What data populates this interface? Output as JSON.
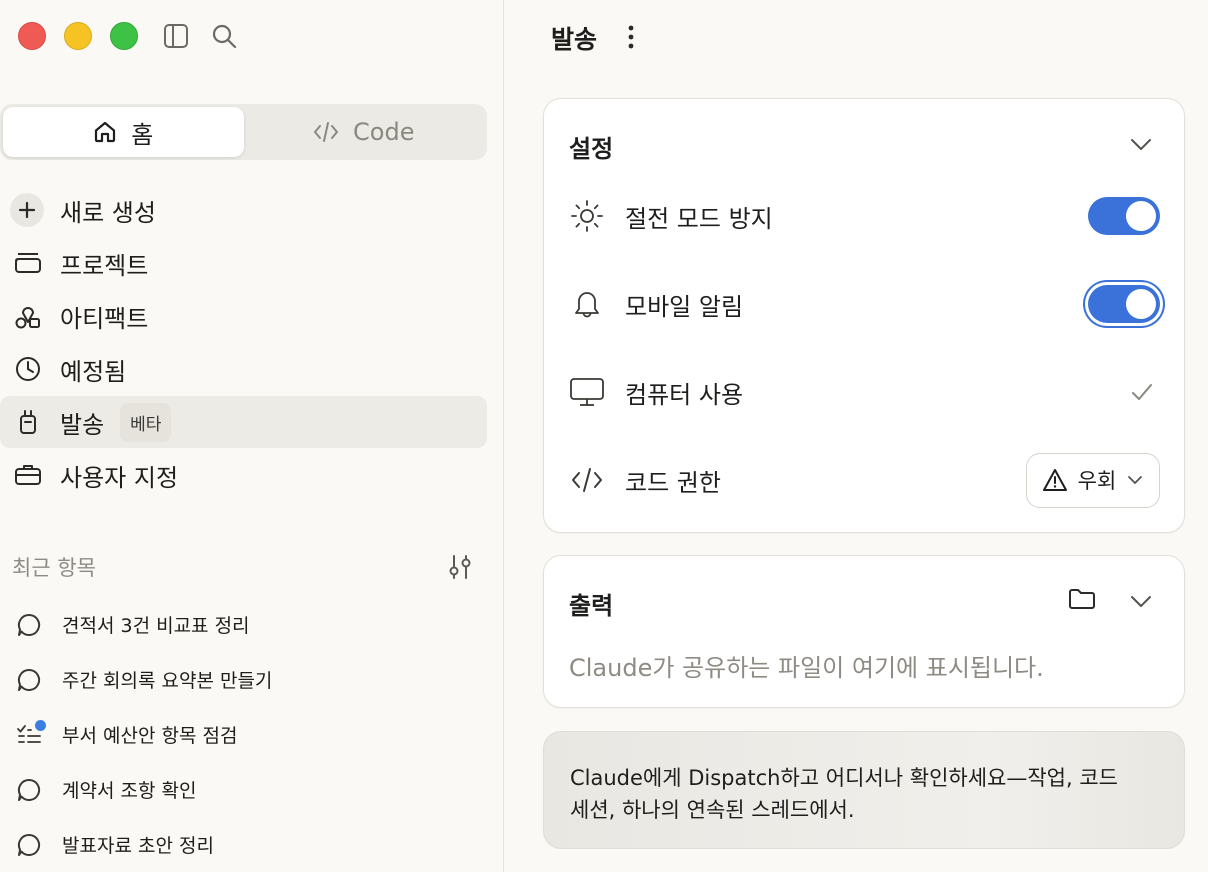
{
  "sidebar": {
    "tabs": [
      {
        "label": "홈",
        "icon": "home-icon",
        "active": true
      },
      {
        "label": "Code",
        "icon": "code-icon",
        "active": false
      }
    ],
    "nav": [
      {
        "label": "새로 생성",
        "icon": "plus-icon"
      },
      {
        "label": "프로젝트",
        "icon": "folder-box-icon"
      },
      {
        "label": "아티팩트",
        "icon": "artifact-icon"
      },
      {
        "label": "예정됨",
        "icon": "clock-icon"
      },
      {
        "label": "발송",
        "icon": "dispatch-icon",
        "badge": "베타",
        "active": true
      },
      {
        "label": "사용자 지정",
        "icon": "briefcase-icon"
      }
    ],
    "recent_title": "최근 항목",
    "recent": [
      {
        "label": "견적서 3건 비교표 정리",
        "icon": "chat-bubble-icon"
      },
      {
        "label": "주간 회의록 요약본 만들기",
        "icon": "chat-bubble-icon"
      },
      {
        "label": "부서 예산안 항목 점검",
        "icon": "task-list-icon",
        "unread": true
      },
      {
        "label": "계약서 조항 확인",
        "icon": "chat-bubble-icon"
      },
      {
        "label": "발표자료 초안 정리",
        "icon": "chat-bubble-icon"
      }
    ]
  },
  "main": {
    "title": "발송",
    "settings": {
      "title": "설정",
      "rows": [
        {
          "label": "절전 모드 방지",
          "icon": "sun-icon",
          "control": "toggle",
          "on": true
        },
        {
          "label": "모바일 알림",
          "icon": "bell-icon",
          "control": "toggle",
          "on": true
        },
        {
          "label": "컴퓨터 사용",
          "icon": "monitor-icon",
          "control": "check"
        },
        {
          "label": "코드 권한",
          "icon": "code-icon",
          "control": "dropdown",
          "value": "우회"
        }
      ]
    },
    "output": {
      "title": "출력",
      "description": "Claude가 공유하는 파일이 여기에 표시됩니다."
    },
    "banner": {
      "line1": "Claude에게 Dispatch하고 어디서나 확인하세요—작업, 코드",
      "line2": "세션, 하나의 연속된 스레드에서."
    }
  },
  "colors": {
    "accent": "#3b72d9",
    "close": "#f05a55",
    "minimize": "#f5c424",
    "maximize": "#3ec245"
  }
}
